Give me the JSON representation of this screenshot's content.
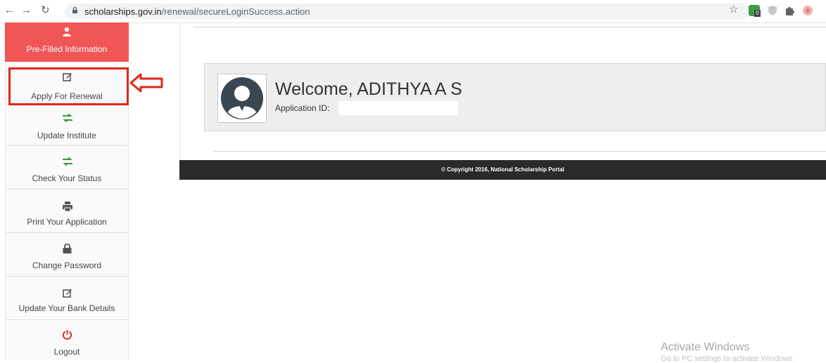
{
  "browser": {
    "url_host": "scholarships.gov.in",
    "url_path": "/renewal/secureLoginSuccess.action",
    "extension_badge": "0"
  },
  "sidebar": {
    "items": [
      {
        "label": "Pre-Filled Information",
        "icon": "user-icon"
      },
      {
        "label": "Apply For Renewal",
        "icon": "edit-icon"
      },
      {
        "label": "Update Institute",
        "icon": "exchange-icon"
      },
      {
        "label": "Check Your Status",
        "icon": "exchange-icon"
      },
      {
        "label": "Print Your Application",
        "icon": "print-icon"
      },
      {
        "label": "Change Password",
        "icon": "lock-icon"
      },
      {
        "label": "Update Your Bank Details",
        "icon": "edit-icon"
      },
      {
        "label": "Logout",
        "icon": "power-icon"
      }
    ]
  },
  "main": {
    "welcome": "Welcome, ADITHYA A S",
    "application_id_label": "Application ID:"
  },
  "footer": {
    "copyright": "© Copyright 2016, National Scholarship Portal"
  },
  "watermark": {
    "line1": "Activate Windows",
    "line2": "Go to PC settings to activate Windows."
  },
  "colors": {
    "active_item": "#f05656",
    "highlight": "#e0261c",
    "footer": "#2a2a2a"
  }
}
